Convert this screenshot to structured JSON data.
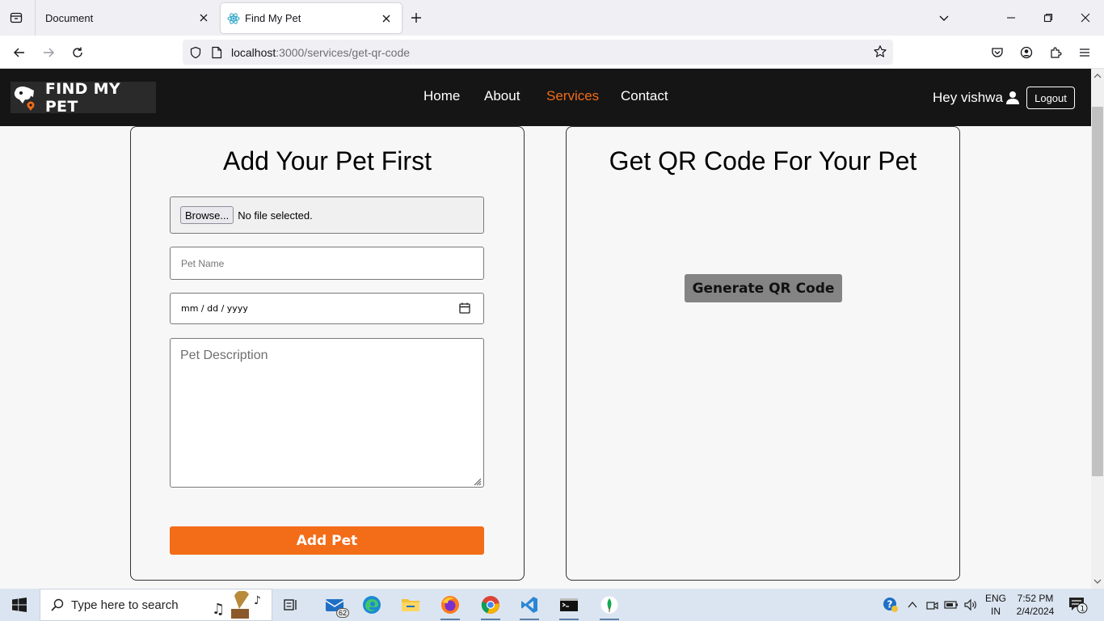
{
  "browser": {
    "tabs": [
      {
        "title": "Document",
        "active": false
      },
      {
        "title": "Find My Pet",
        "active": true
      }
    ],
    "url_host": "localhost",
    "url_rest": ":3000/services/get-qr-code"
  },
  "site": {
    "logo_text": "FIND MY PET",
    "nav": [
      {
        "label": "Home",
        "active": false
      },
      {
        "label": "About",
        "active": false
      },
      {
        "label": "Services",
        "active": true
      },
      {
        "label": "Contact",
        "active": false
      }
    ],
    "greeting": "Hey vishwa",
    "logout_label": "Logout",
    "accent_color": "#f36c17"
  },
  "add_pet": {
    "title": "Add Your Pet First",
    "browse_label": "Browse...",
    "file_status": "No file selected.",
    "pet_name_placeholder": "Pet Name",
    "date_placeholder": "mm / dd / yyyy",
    "description_placeholder": "Pet Description",
    "submit_label": "Add Pet"
  },
  "qr": {
    "title": "Get QR Code For Your Pet",
    "generate_label": "Generate QR Code"
  },
  "taskbar": {
    "search_placeholder": "Type here to search",
    "mail_badge": "62",
    "lang_top": "ENG",
    "lang_bottom": "IN",
    "time": "7:52 PM",
    "date": "2/4/2024",
    "notification_count": "1"
  }
}
